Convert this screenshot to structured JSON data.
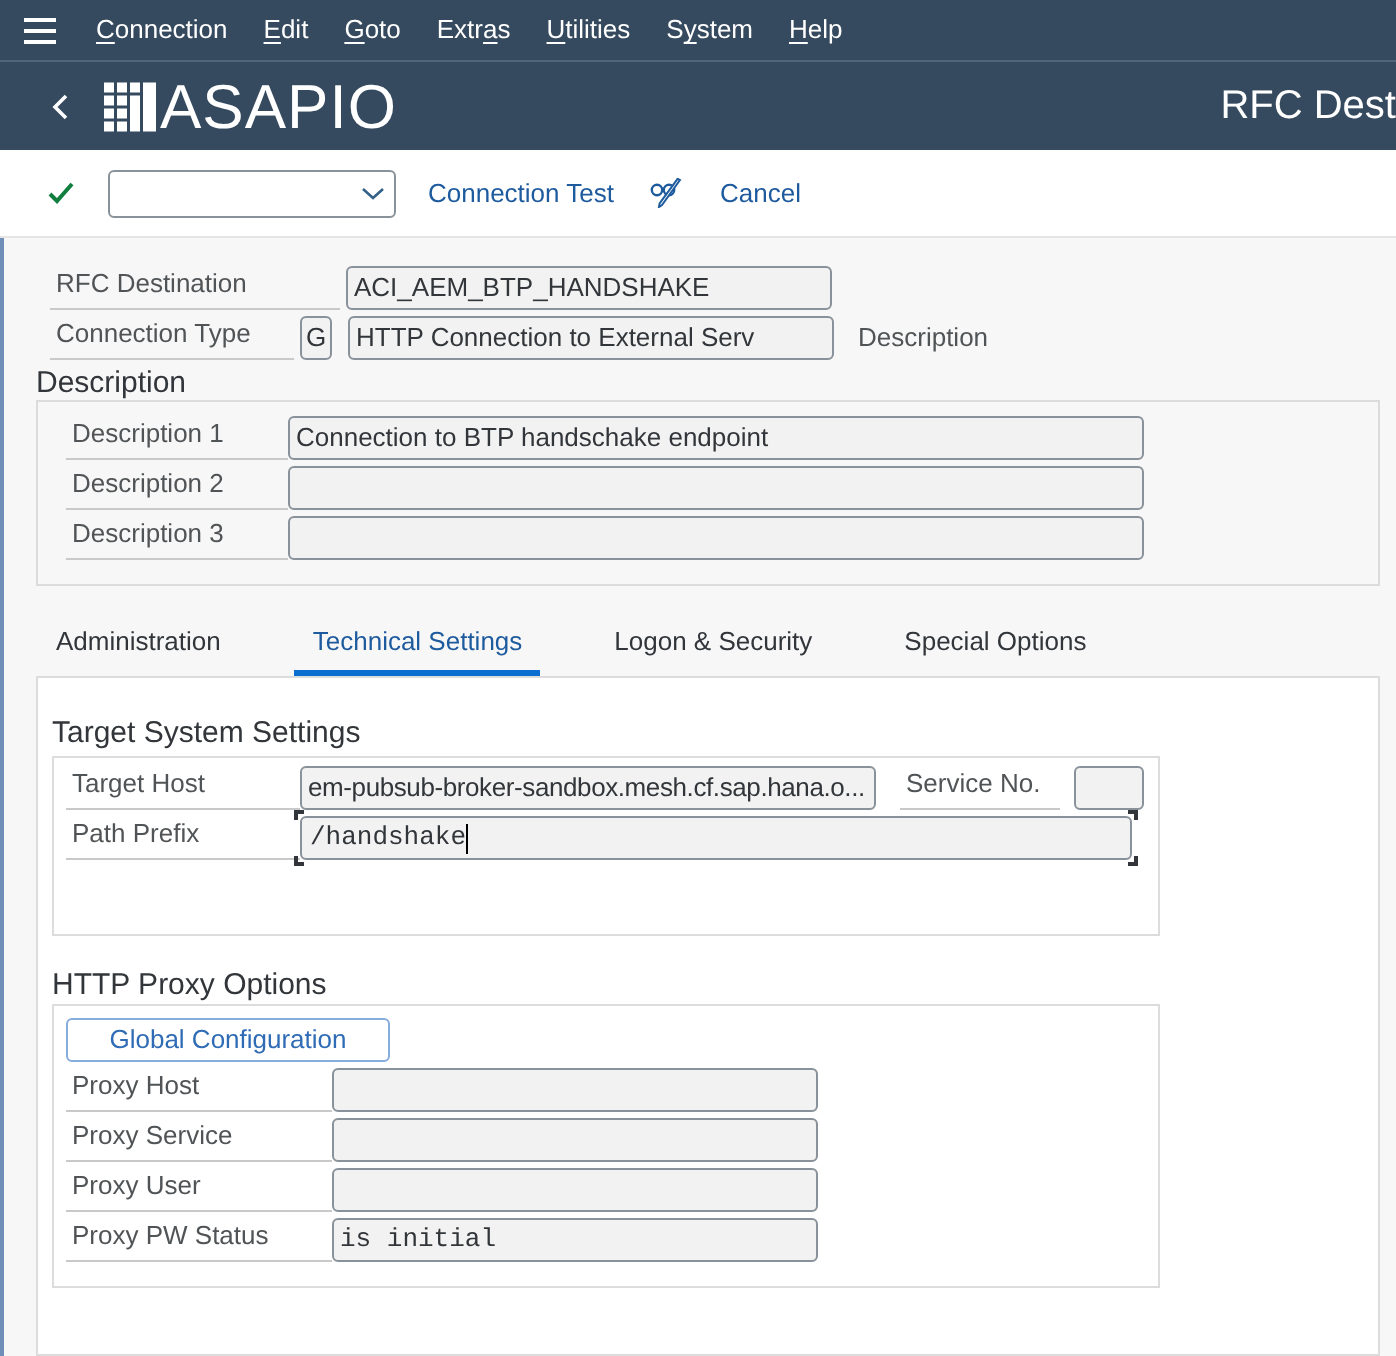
{
  "menu_bar": {
    "items": [
      {
        "key": "C",
        "post": "onnection"
      },
      {
        "key": "E",
        "post": "dit"
      },
      {
        "key": "G",
        "post": "oto"
      },
      {
        "pre": "Extr",
        "key": "a",
        "post": "s"
      },
      {
        "key": "U",
        "post": "tilities"
      },
      {
        "pre": "S",
        "key": "y",
        "post": "stem"
      },
      {
        "key": "H",
        "post": "elp"
      }
    ]
  },
  "header": {
    "logo": "ASAPIO",
    "title": "RFC Dest"
  },
  "toolbar": {
    "connection_test": "Connection Test",
    "cancel": "Cancel"
  },
  "header_fields": {
    "rfc_destination": {
      "label": "RFC Destination",
      "value": "ACI_AEM_BTP_HANDSHAKE"
    },
    "connection_type": {
      "label": "Connection Type",
      "code": "G",
      "value": "HTTP Connection to External Serv",
      "note": "Description"
    }
  },
  "description": {
    "title": "Description",
    "rows": [
      {
        "label": "Description 1",
        "value": "Connection to BTP handschake endpoint"
      },
      {
        "label": "Description 2"
      },
      {
        "label": "Description 3"
      }
    ]
  },
  "tabs": [
    {
      "label": "Administration",
      "selected": false
    },
    {
      "label": "Technical Settings",
      "selected": true
    },
    {
      "label": "Logon & Security",
      "selected": false
    },
    {
      "label": "Special Options",
      "selected": false
    }
  ],
  "target_system": {
    "title": "Target System Settings",
    "target_host": {
      "label": "Target Host",
      "value": "em-pubsub-broker-sandbox.mesh.cf.sap.hana.o..."
    },
    "service_no": {
      "label": "Service No."
    },
    "path_prefix": {
      "label": "Path Prefix",
      "value": "/handshake",
      "focused": true
    }
  },
  "proxy": {
    "title": "HTTP Proxy Options",
    "button": "Global Configuration",
    "rows": [
      {
        "label": "Proxy Host"
      },
      {
        "label": "Proxy Service"
      },
      {
        "label": "Proxy User"
      },
      {
        "label": "Proxy PW Status",
        "value": "is initial"
      }
    ]
  }
}
